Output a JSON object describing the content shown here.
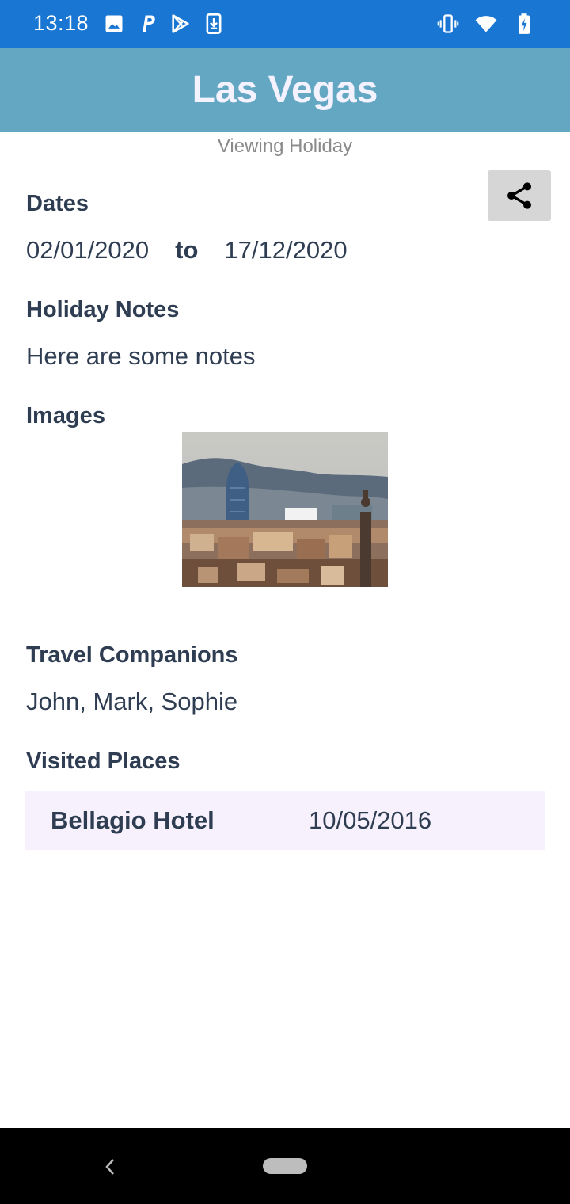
{
  "status_bar": {
    "time": "13:18",
    "left_icons": [
      "image-icon",
      "parking-icon",
      "play-store-icon",
      "download-icon"
    ],
    "right_icons": [
      "vibrate-icon",
      "wifi-icon",
      "battery-charging-icon"
    ],
    "background": "#1976d2"
  },
  "header": {
    "title": "Las Vegas",
    "background": "#64a7c2"
  },
  "subtitle": "Viewing Holiday",
  "share_button": {
    "icon": "share-icon"
  },
  "dates": {
    "heading": "Dates",
    "start": "02/01/2020",
    "separator": "to",
    "end": "17/12/2020"
  },
  "notes": {
    "heading": "Holiday Notes",
    "text": "Here are some notes"
  },
  "images": {
    "heading": "Images",
    "items": [
      {
        "alt": "city-skyline-photo"
      }
    ]
  },
  "companions": {
    "heading": "Travel Companions",
    "text": "John, Mark, Sophie"
  },
  "visited_places": {
    "heading": "Visited Places",
    "rows": [
      {
        "name": "Bellagio Hotel",
        "date": "10/05/2016"
      }
    ]
  },
  "nav_bar": {
    "back_icon": "back-chevron-icon",
    "home_icon": "home-pill-icon"
  }
}
